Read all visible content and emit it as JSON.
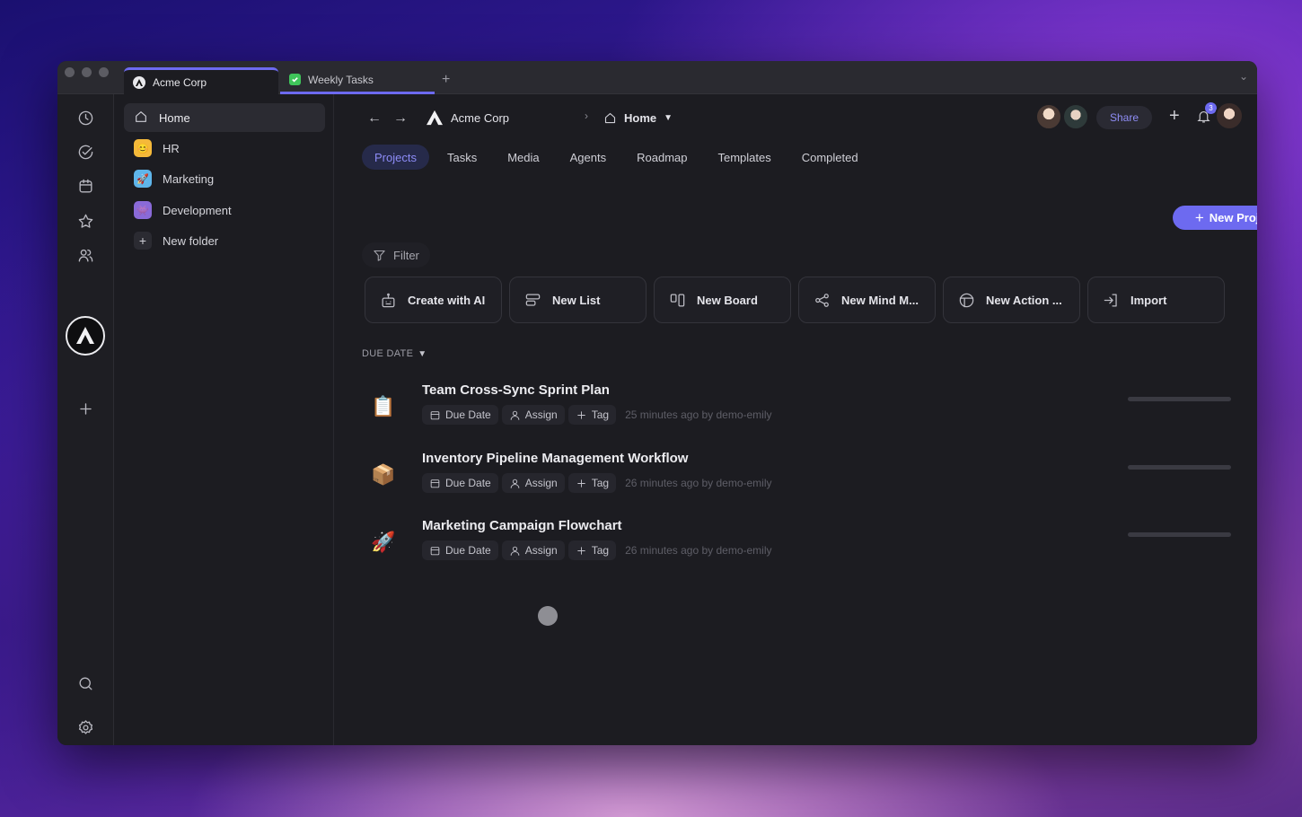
{
  "tabs": [
    {
      "label": "Acme Corp",
      "icon": "acme-logo-icon",
      "active": true
    },
    {
      "label": "Weekly Tasks",
      "icon": "check-square-icon",
      "active": false
    }
  ],
  "sidebar": {
    "items": [
      {
        "label": "Home",
        "icon": "home-icon",
        "active": true
      },
      {
        "label": "HR",
        "emoji": "😊",
        "color": "#f5b93a"
      },
      {
        "label": "Marketing",
        "emoji": "🚀",
        "color": "#5fb5ea"
      },
      {
        "label": "Development",
        "emoji": "👾",
        "color": "#8a6ad8"
      },
      {
        "label": "New folder",
        "icon": "plus-icon"
      }
    ]
  },
  "breadcrumb": {
    "workspace": "Acme Corp",
    "page": "Home"
  },
  "header": {
    "share_label": "Share",
    "notification_count": "3"
  },
  "project_tabs": [
    "Projects",
    "Tasks",
    "Media",
    "Agents",
    "Roadmap",
    "Templates",
    "Completed"
  ],
  "new_project_label": "New Project",
  "filter_label": "Filter",
  "actions": [
    {
      "label": "Create with AI",
      "icon": "robot-icon"
    },
    {
      "label": "New List",
      "icon": "list-icon"
    },
    {
      "label": "New Board",
      "icon": "board-icon"
    },
    {
      "label": "New Mind M...",
      "icon": "mind-map-icon"
    },
    {
      "label": "New Action ...",
      "icon": "action-table-icon"
    },
    {
      "label": "Import",
      "icon": "import-icon"
    }
  ],
  "group_label": "DUE DATE",
  "chip_labels": {
    "due": "Due Date",
    "assign": "Assign",
    "tag": "Tag"
  },
  "projects": [
    {
      "title": "Team Cross-Sync Sprint Plan",
      "emoji": "📋",
      "meta": "25 minutes ago by demo-emily",
      "progress": 0
    },
    {
      "title": "Inventory Pipeline Management Workflow",
      "emoji": "📦",
      "meta": "26 minutes ago by demo-emily",
      "progress": 0
    },
    {
      "title": "Marketing Campaign Flowchart",
      "emoji": "🚀",
      "meta": "26 minutes ago by demo-emily",
      "progress": 0
    }
  ],
  "colors": {
    "accent": "#6d6af0",
    "background": "#1c1c21"
  }
}
